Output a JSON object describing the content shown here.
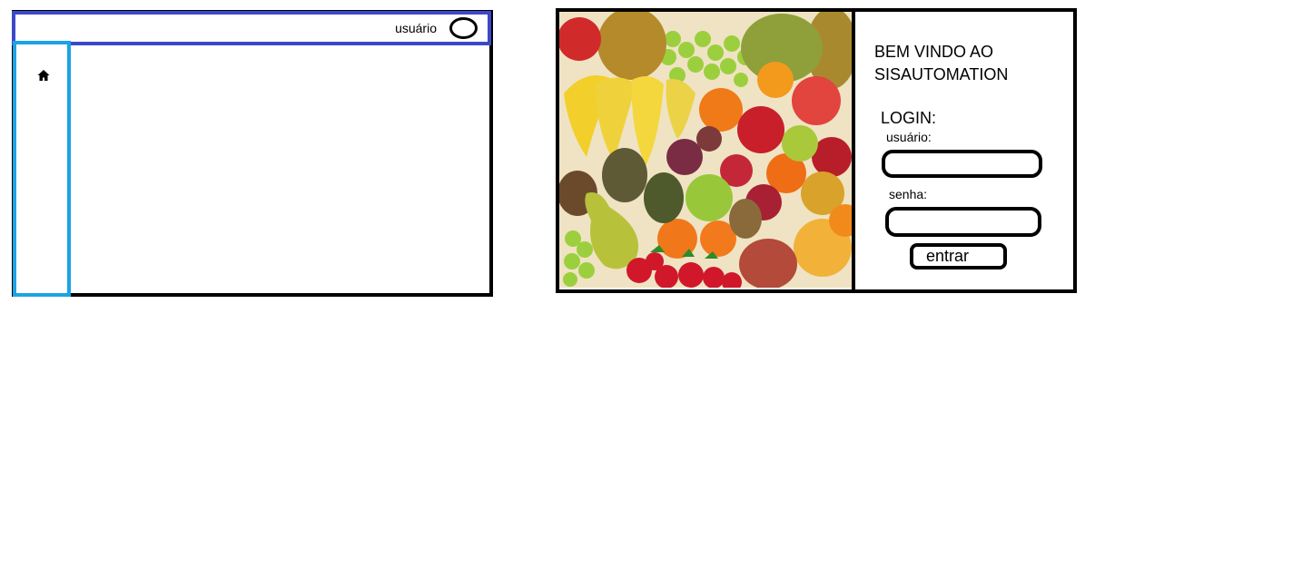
{
  "dashboard": {
    "topbar": {
      "user_label": "usuário",
      "avatar_icon": "avatar-circle-icon"
    },
    "sidebar": {
      "items": [
        {
          "icon": "home-icon"
        }
      ]
    },
    "colors": {
      "topbar_border": "#3c48c8",
      "sidebar_border": "#1ba3e5"
    }
  },
  "login": {
    "welcome_text": "BEM VINDO AO SISAUTOMATION",
    "title": "LOGIN:",
    "username_label": "usuário:",
    "username_value": "",
    "password_label": "senha:",
    "password_value": "",
    "submit_label": "entrar",
    "image": "fruit-assortment-photo"
  }
}
